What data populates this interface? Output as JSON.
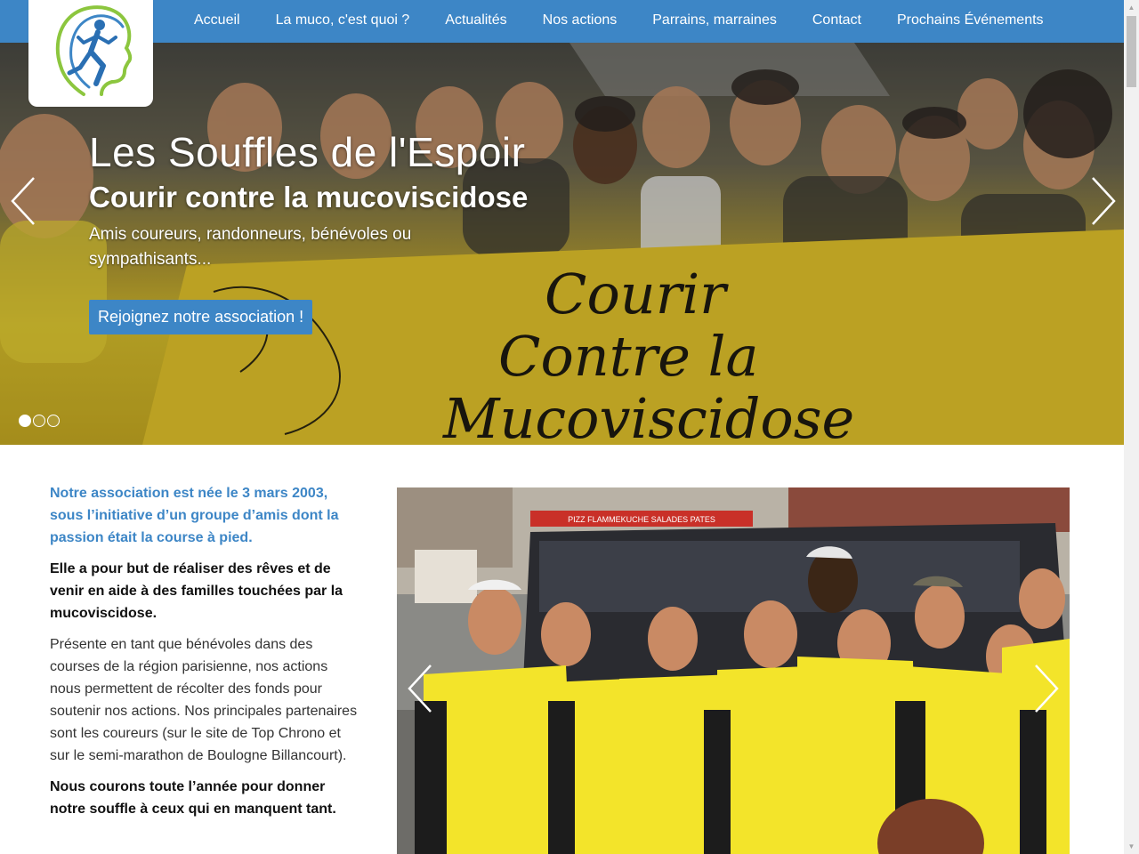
{
  "nav": {
    "items": [
      {
        "label": "Accueil"
      },
      {
        "label": "La muco, c'est quoi ?"
      },
      {
        "label": "Actualités"
      },
      {
        "label": "Nos actions"
      },
      {
        "label": "Parrains, marraines"
      },
      {
        "label": "Contact"
      },
      {
        "label": "Prochains Événements"
      }
    ]
  },
  "logo": {
    "icon": "runner-head-logo"
  },
  "hero": {
    "title": "Les Souffles de l'Espoir",
    "subtitle": "Courir contre la mucoviscidose",
    "text": "Amis coureurs, randonneurs, bénévoles ou sympathisants...",
    "button_label": "Rejoignez notre association !",
    "banner_lines": [
      "Courir",
      "Contre la",
      "Mucoviscidose"
    ],
    "slides": 3,
    "active_slide": 1
  },
  "intro": {
    "lead": "Notre association est née le 3 mars 2003, sous l’initiative d’un groupe d’amis dont la passion était la course à pied.",
    "goal": "Elle a pour but de réaliser des rêves et de venir en aide à des familles touchées par la mucoviscidose.",
    "body": "Présente en tant que bénévoles dans des courses de la région parisienne, nos actions nous permettent de récolter des fonds pour soutenir nos actions. Nos principales partenaires sont les coureurs (sur le site de Top Chrono et sur le semi-marathon de Boulogne Billancourt).",
    "closing": "Nous courons toute l’année pour donner notre souffle à ceux qui en manquent tant."
  },
  "photo": {
    "shop_sign": "PIZZ FLAMMEKUCHE  SALADES PATES"
  },
  "colors": {
    "primary": "#3d86c6",
    "banner_yellow": "#e7c92a",
    "shirt_yellow": "#f3e42a"
  }
}
